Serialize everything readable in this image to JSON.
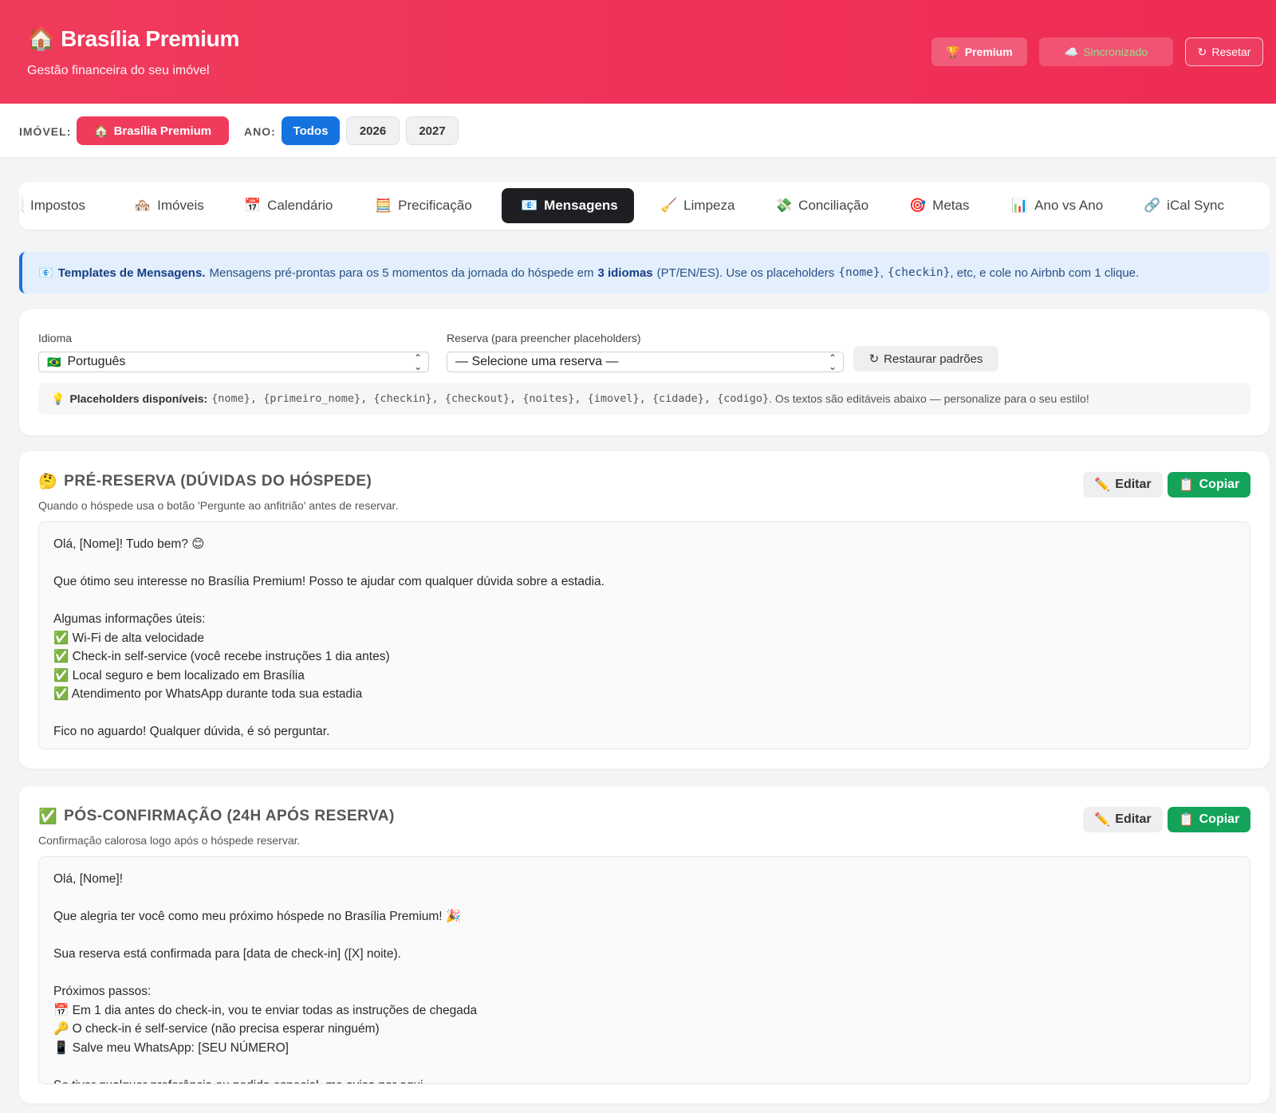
{
  "header": {
    "brand_icon": "🏠",
    "brand": "Brasília Premium",
    "subtitle": "Gestão financeira do seu imóvel",
    "premium_icon": "🏆",
    "premium_label": "Premium",
    "sync_icon": "☁️",
    "sync_label": "Sincronizado",
    "reset_icon": "↻",
    "reset_label": "Resetar"
  },
  "filters": {
    "property_label": "IMÓVEL:",
    "property_icon": "🏠",
    "property_value": "Brasília Premium",
    "year_label": "ANO:",
    "years": [
      "Todos",
      "2026",
      "2027"
    ],
    "active_year": "Todos"
  },
  "tabs": [
    {
      "icon": "📑",
      "label": "Impostos"
    },
    {
      "icon": "🏘️",
      "label": "Imóveis"
    },
    {
      "icon": "📅",
      "label": "Calendário"
    },
    {
      "icon": "🧮",
      "label": "Precificação"
    },
    {
      "icon": "📧",
      "label": "Mensagens",
      "active": true
    },
    {
      "icon": "🧹",
      "label": "Limpeza"
    },
    {
      "icon": "💸",
      "label": "Conciliação"
    },
    {
      "icon": "🎯",
      "label": "Metas"
    },
    {
      "icon": "📊",
      "label": "Ano vs Ano"
    },
    {
      "icon": "🔗",
      "label": "iCal Sync"
    }
  ],
  "banner": {
    "icon": "📧",
    "title": "Templates de Mensagens.",
    "text1": "Mensagens pré-prontas para os 5 momentos da jornada do hóspede em",
    "bold": "3 idiomas",
    "text2": "(PT/EN/ES). Use os placeholders",
    "ph1": "{nome}",
    "comma": ",",
    "ph2": "{checkin}",
    "text3": ", etc, e cole no Airbnb com 1 clique."
  },
  "controls": {
    "language_label": "Idioma",
    "language_flag": "🇧🇷",
    "language_value": "Português",
    "reservation_label": "Reserva (para preencher placeholders)",
    "reservation_value": "— Selecione uma reserva —",
    "restore_icon": "↻",
    "restore_label": "Restaurar padrões",
    "placeholders_icon": "💡",
    "placeholders_title": "Placeholders disponíveis:",
    "placeholders_list": "{nome}, {primeiro_nome}, {checkin}, {checkout}, {noites}, {imovel}, {cidade}, {codigo}",
    "placeholders_note": ". Os textos são editáveis abaixo — personalize para o seu estilo!"
  },
  "messages": [
    {
      "icon": "🤔",
      "title": "PRÉ-RESERVA (DÚVIDAS DO HÓSPEDE)",
      "description": "Quando o hóspede usa o botão 'Pergunte ao anfitrião' antes de reservar.",
      "edit_icon": "✏️",
      "edit_label": "Editar",
      "copy_icon": "📋",
      "copy_label": "Copiar",
      "lines": [
        "Olá, [Nome]! Tudo bem? 😊",
        "",
        "Que ótimo seu interesse no Brasília Premium! Posso te ajudar com qualquer dúvida sobre a estadia.",
        "",
        "Algumas informações úteis:",
        "✅ Wi-Fi de alta velocidade",
        "✅ Check-in self-service (você recebe instruções 1 dia antes)",
        "✅ Local seguro e bem localizado em Brasília",
        "✅ Atendimento por WhatsApp durante toda sua estadia",
        "",
        "Fico no aguardo! Qualquer dúvida, é só perguntar."
      ]
    },
    {
      "icon": "✅",
      "title": "PÓS-CONFIRMAÇÃO (24H APÓS RESERVA)",
      "description": "Confirmação calorosa logo após o hóspede reservar.",
      "edit_icon": "✏️",
      "edit_label": "Editar",
      "copy_icon": "📋",
      "copy_label": "Copiar",
      "lines": [
        "Olá, [Nome]!",
        "",
        "Que alegria ter você como meu próximo hóspede no Brasília Premium! 🎉",
        "",
        "Sua reserva está confirmada para [data de check-in] ([X] noite).",
        "",
        "Próximos passos:",
        "📅 Em 1 dia antes do check-in, vou te enviar todas as instruções de chegada",
        "🔑 O check-in é self-service (não precisa esperar ninguém)",
        "📱 Salve meu WhatsApp: [SEU NÚMERO]",
        "",
        "Se tiver qualquer preferência ou pedido especial, me avisa por aqui."
      ]
    }
  ]
}
